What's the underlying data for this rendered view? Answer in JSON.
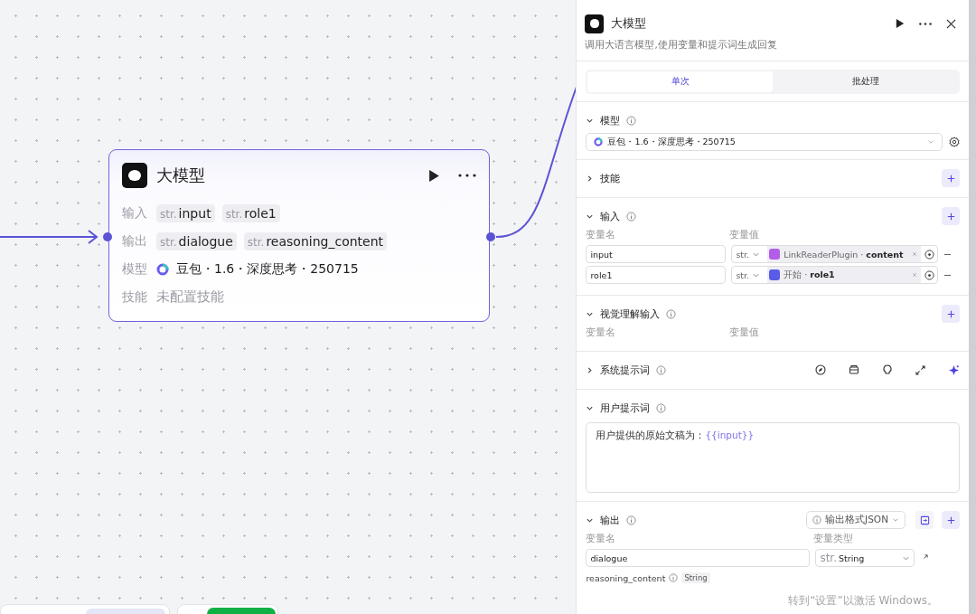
{
  "node": {
    "title": "大模型",
    "rows": [
      {
        "kind": "tags",
        "label": "输入",
        "tags": [
          {
            "type": "str.",
            "name": "input"
          },
          {
            "type": "str.",
            "name": "role1"
          }
        ]
      },
      {
        "kind": "tags",
        "label": "输出",
        "tags": [
          {
            "type": "str.",
            "name": "dialogue"
          },
          {
            "type": "str.",
            "name": "reasoning_content"
          }
        ]
      },
      {
        "kind": "model",
        "label": "模型",
        "value": "豆包・1.6・深度思考・250715"
      },
      {
        "kind": "text",
        "label": "技能",
        "value": "未配置技能"
      }
    ]
  },
  "panel": {
    "title": "大模型",
    "description": "调用大语言模型,使用变量和提示词生成回复",
    "tabs": [
      {
        "label": "单次",
        "selected": true
      },
      {
        "label": "批处理",
        "selected": false
      }
    ],
    "sections": [
      {
        "kind": "model",
        "title": "模型",
        "expanded": true,
        "info": true,
        "add": false,
        "value": "豆包・1.6・深度思考・250715"
      },
      {
        "kind": "plain",
        "title": "技能",
        "expanded": false,
        "info": false,
        "add": true
      },
      {
        "kind": "inputs",
        "title": "输入",
        "expanded": true,
        "info": true,
        "add": true,
        "columns": [
          "变量名",
          "变量值"
        ],
        "rows": [
          {
            "name": "input",
            "type": "str.",
            "reference": "LinkReaderPlugin · **content**",
            "color": "#b35ee8"
          },
          {
            "name": "role1",
            "type": "str.",
            "reference": "开始 · **role1**",
            "color": "#5a5ce8"
          }
        ]
      },
      {
        "kind": "inputs",
        "title": "视觉理解输入",
        "expanded": true,
        "info": true,
        "add": true,
        "columns": [
          "变量名",
          "变量值"
        ]
      },
      {
        "kind": "tools",
        "title": "系统提示词",
        "expanded": false,
        "info": true,
        "add": false
      },
      {
        "kind": "prompt",
        "title": "用户提示词",
        "expanded": true,
        "info": true,
        "add": false,
        "text": "用户提供的原始文稿为：",
        "variable": "{{input}}"
      },
      {
        "kind": "outputs",
        "title": "输出",
        "expanded": true,
        "info": true,
        "add": true,
        "format": "输出格式JSON",
        "columns": [
          "变量名",
          "变量类型"
        ],
        "rows": [
          {
            "kind": "field",
            "name": "dialogue",
            "type": "str.",
            "type_name": "String"
          },
          {
            "kind": "tag",
            "name": "reasoning_content",
            "type_name": "String"
          }
        ]
      }
    ]
  },
  "activation_notice": "转到“设置”以激活 Windows。"
}
